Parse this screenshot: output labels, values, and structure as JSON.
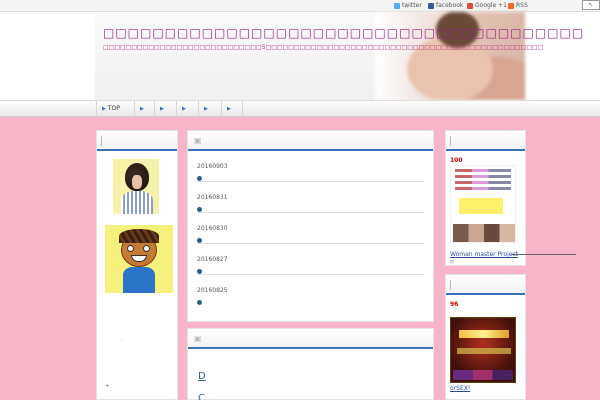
{
  "social": {
    "twitter": "twitter",
    "facebook": "facebook",
    "google": "Google +1",
    "rss": "RSS"
  },
  "header": {
    "title": "□□□□□□□□□□□□□□□□□□□□□□□□□□□□□□□□□□□□□□□",
    "description": "□□□□□□□□□□□□□□□□□□□□□□□□□□□□5□□□□□□□□□□□□□□□□□□□□□□□□□□□□□□□□□□□□□□□□□□□□□□□□□□□□□□□□□□□□□□"
  },
  "nav": {
    "items": [
      {
        "label": "TOP"
      },
      {
        "label": ""
      },
      {
        "label": ""
      },
      {
        "label": ""
      },
      {
        "label": ""
      },
      {
        "label": ""
      }
    ]
  },
  "main": {
    "posts": [
      {
        "date": "20160903"
      },
      {
        "date": "20160831"
      },
      {
        "date": "20160830"
      },
      {
        "date": "20160827"
      },
      {
        "date": "20160825"
      }
    ],
    "section2": {
      "item1": "D",
      "item2": "C"
    }
  },
  "right": {
    "ad1": {
      "number": "100",
      "link": "Woman master Project",
      "sub": "!!"
    },
    "ad2": {
      "number": "96",
      "link": "orSEX!"
    }
  },
  "left": {
    "dot1": ".",
    "dot2": "+"
  },
  "colors": {
    "background": "#f8b4c8",
    "accent": "#3a74b8",
    "title": "#a0208a"
  }
}
